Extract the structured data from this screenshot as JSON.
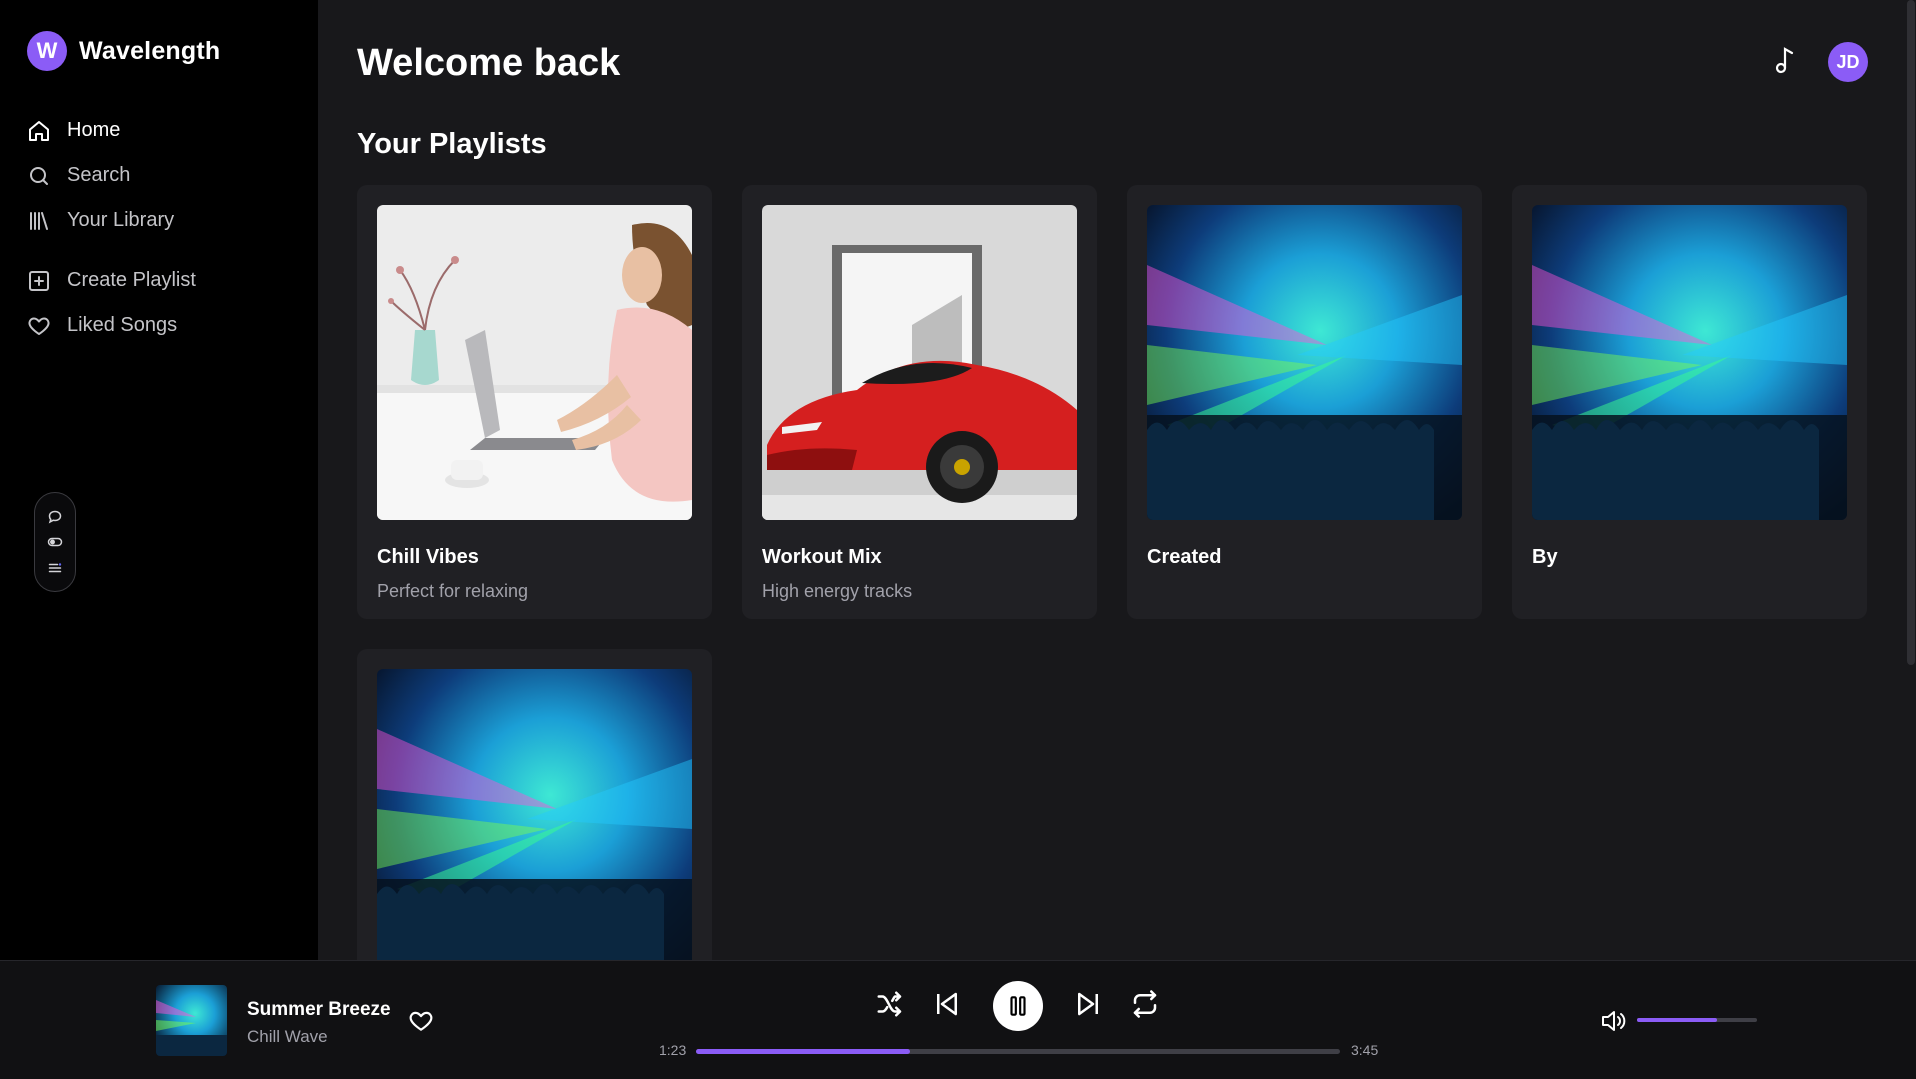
{
  "brand": {
    "logo_letter": "W",
    "name": "Wavelength"
  },
  "nav": {
    "items": [
      {
        "label": "Home",
        "icon": "home-icon",
        "active": true
      },
      {
        "label": "Search",
        "icon": "search-icon"
      },
      {
        "label": "Your Library",
        "icon": "library-icon"
      }
    ],
    "actions": [
      {
        "label": "Create Playlist",
        "icon": "plus-square-icon"
      },
      {
        "label": "Liked Songs",
        "icon": "heart-icon"
      }
    ]
  },
  "header": {
    "title": "Welcome back",
    "avatar_initials": "JD"
  },
  "section": {
    "title": "Your Playlists"
  },
  "playlists": [
    {
      "title": "Chill Vibes",
      "subtitle": "Perfect for relaxing",
      "art": "woman at laptop"
    },
    {
      "title": "Workout Mix",
      "subtitle": "High energy tracks",
      "art": "red sports car"
    },
    {
      "title": "Created",
      "subtitle": "",
      "art": "concert crowd"
    },
    {
      "title": "By",
      "subtitle": "",
      "art": "concert crowd"
    },
    {
      "title": "",
      "subtitle": "",
      "art": "concert crowd"
    }
  ],
  "player": {
    "track_title": "Summer Breeze",
    "artist": "Chill Wave",
    "current_time": "1:23",
    "total_time": "3:45",
    "progress": 0.333,
    "volume": 0.67
  },
  "colors": {
    "accent": "#8b5cf6",
    "background": "#18181b",
    "sidebar": "#000000",
    "card": "#202024"
  }
}
